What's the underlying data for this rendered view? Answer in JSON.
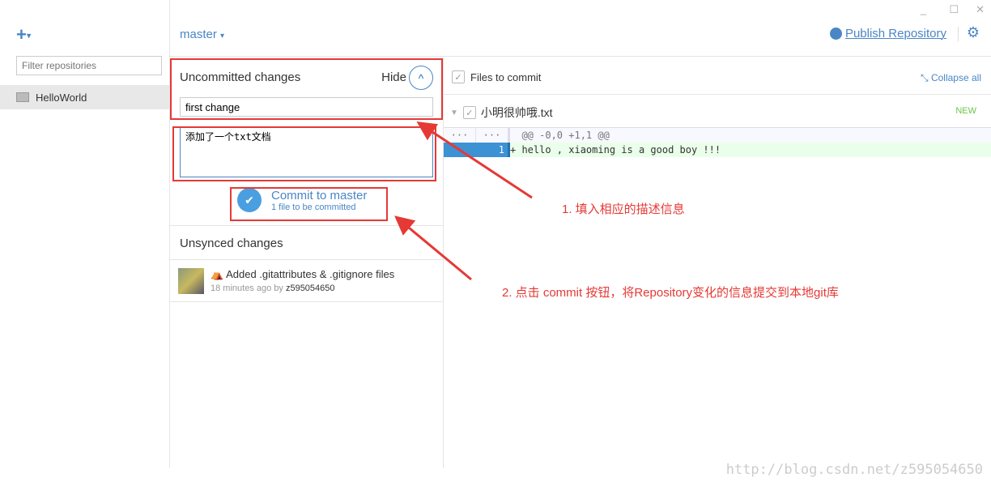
{
  "window": {
    "minimize": "_",
    "maximize": "☐",
    "close": "✕"
  },
  "sidebar": {
    "add_label": "+",
    "add_caret": "▾",
    "filter_placeholder": "Filter repositories",
    "repos": [
      {
        "name": "HelloWorld"
      }
    ]
  },
  "header": {
    "branch": "master",
    "branch_caret": "▾",
    "publish": "Publish Repository"
  },
  "uncommitted": {
    "title": "Uncommitted changes",
    "hide": "Hide",
    "summary_value": "first change",
    "description_value": "添加了一个txt文档",
    "commit_label": "Commit to master",
    "commit_sub": "1 file to be committed"
  },
  "unsynced": {
    "title": "Unsynced changes",
    "commits": [
      {
        "message": "Added .gitattributes & .gitignore files",
        "time": "18 minutes ago by",
        "author": "z595054650"
      }
    ]
  },
  "files": {
    "header": "Files to commit",
    "collapse": "Collapse all",
    "file": {
      "name": "小明很帅哦.txt",
      "status": "NEW"
    },
    "diff": [
      {
        "old": "···",
        "new": "···",
        "text": "  @@ -0,0 +1,1 @@"
      },
      {
        "old": "",
        "new": "1",
        "text": "+ hello , xiaoming is a good boy !!!"
      }
    ]
  },
  "annotations": {
    "step1": "1. 填入相应的描述信息",
    "step2": "2. 点击 commit 按钮，将Repository变化的信息提交到本地git库",
    "watermark": "http://blog.csdn.net/z595054650"
  },
  "colors": {
    "accent": "#4a86c5",
    "annotation": "#e53935",
    "new_badge": "#6cc644",
    "diff_add_bg": "#eaffea"
  }
}
